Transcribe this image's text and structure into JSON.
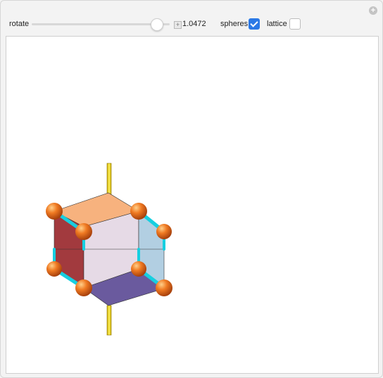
{
  "controls": {
    "rotate_label": "rotate",
    "rotate_value_text": "1.0472",
    "rotate_fraction": 0.95,
    "spheres_label": "spheres",
    "spheres_checked": true,
    "lattice_label": "lattice",
    "lattice_checked": false
  },
  "colors": {
    "accent": "#2b79e6",
    "face_top": "#f7b27e",
    "face_left": "#a23a3e",
    "face_front": "#e6dae6",
    "face_right": "#b2cfe2",
    "face_bottom": "#6a5a9e",
    "axis": "#f2dc18",
    "bond": "#16cfe0",
    "sphere": "#f07a22"
  }
}
